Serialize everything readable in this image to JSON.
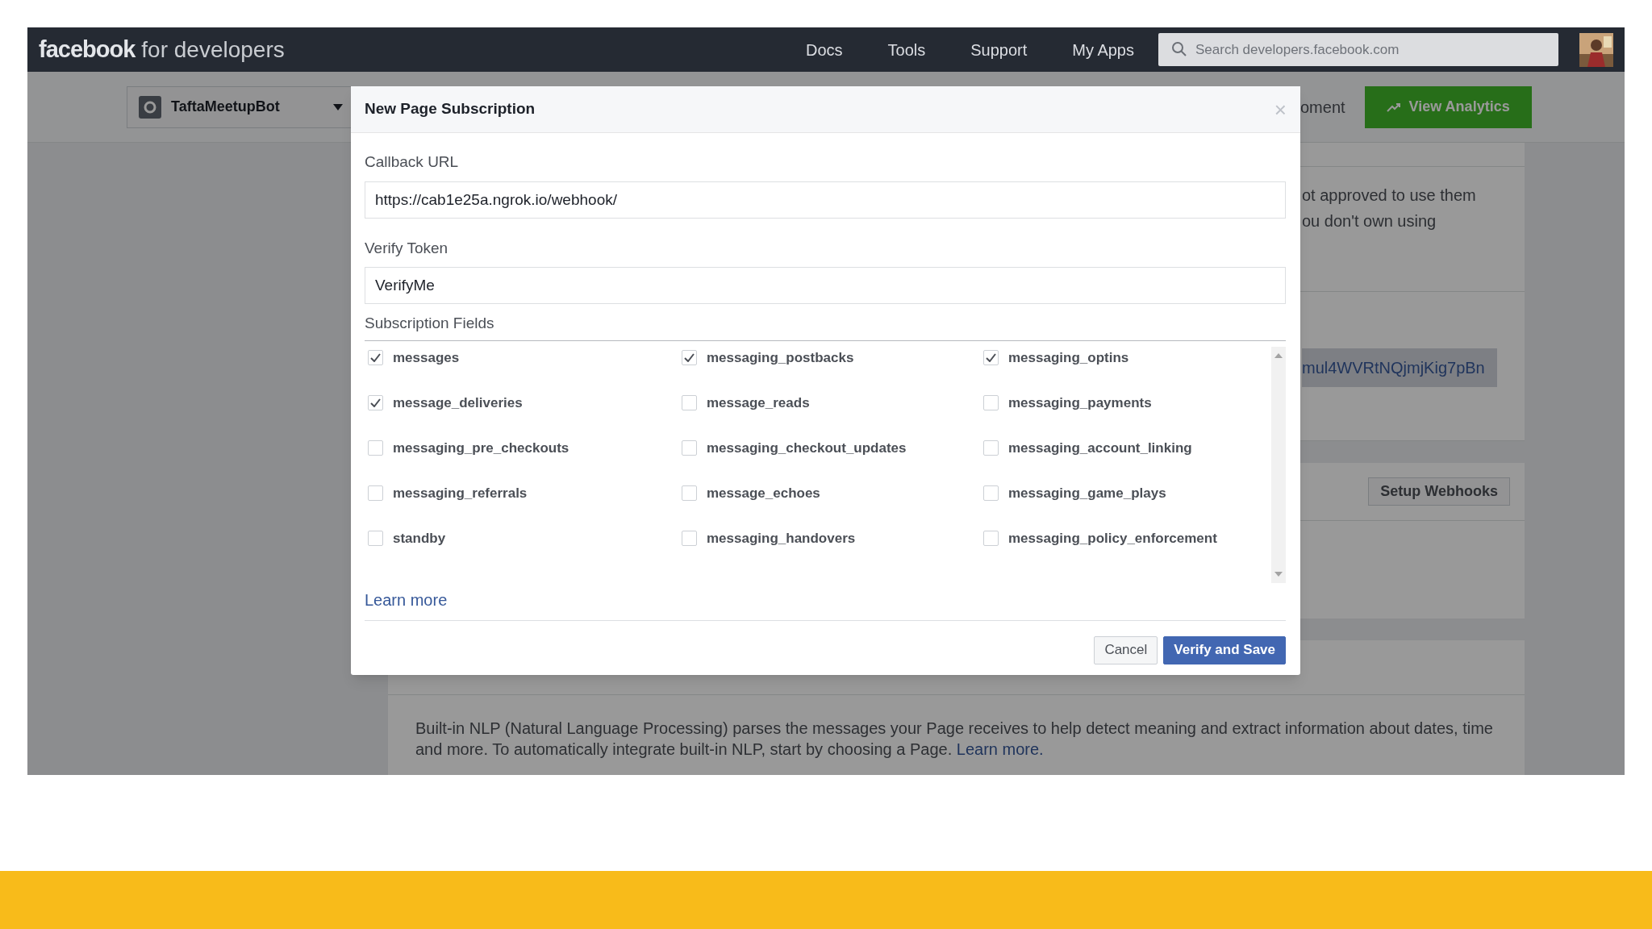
{
  "topbar": {
    "logo_bold": "facebook",
    "logo_rest": "for developers",
    "nav": [
      "Docs",
      "Tools",
      "Support",
      "My Apps"
    ],
    "search": {
      "placeholder": "Search developers.facebook.com"
    }
  },
  "app_bar": {
    "app_name": "TaftaMeetupBot",
    "tab_fragment": "oment",
    "analytics_button": "View Analytics"
  },
  "background": {
    "permissions_text": [
      "ot approved to use them",
      "ou don't own using"
    ],
    "token_fragment": "mul4WVRtNQjmjKig7pBn",
    "webhooks_button": "Setup Webhooks",
    "nlp_text": "Built-in NLP (Natural Language Processing) parses the messages your Page receives to help detect meaning and extract information about dates, time and more. To automatically integrate built-in NLP, start by choosing a Page.",
    "nlp_link": "Learn more."
  },
  "dialog": {
    "title": "New Page Subscription",
    "close": "×",
    "inputs": [
      {
        "label": "Callback URL",
        "value": "https://cab1e25a.ngrok.io/webhook/"
      },
      {
        "label": "Verify Token",
        "value": "VerifyMe"
      }
    ],
    "subscription_label": "Subscription Fields",
    "fields": [
      {
        "label": "messages",
        "checked": true
      },
      {
        "label": "messaging_postbacks",
        "checked": true
      },
      {
        "label": "messaging_optins",
        "checked": true
      },
      {
        "label": "message_deliveries",
        "checked": true
      },
      {
        "label": "message_reads",
        "checked": false
      },
      {
        "label": "messaging_payments",
        "checked": false
      },
      {
        "label": "messaging_pre_checkouts",
        "checked": false
      },
      {
        "label": "messaging_checkout_updates",
        "checked": false
      },
      {
        "label": "messaging_account_linking",
        "checked": false
      },
      {
        "label": "messaging_referrals",
        "checked": false
      },
      {
        "label": "message_echoes",
        "checked": false
      },
      {
        "label": "messaging_game_plays",
        "checked": false
      },
      {
        "label": "standby",
        "checked": false
      },
      {
        "label": "messaging_handovers",
        "checked": false
      },
      {
        "label": "messaging_policy_enforcement",
        "checked": false
      }
    ],
    "learn_more": "Learn more",
    "cancel": "Cancel",
    "submit": "Verify and Save"
  }
}
